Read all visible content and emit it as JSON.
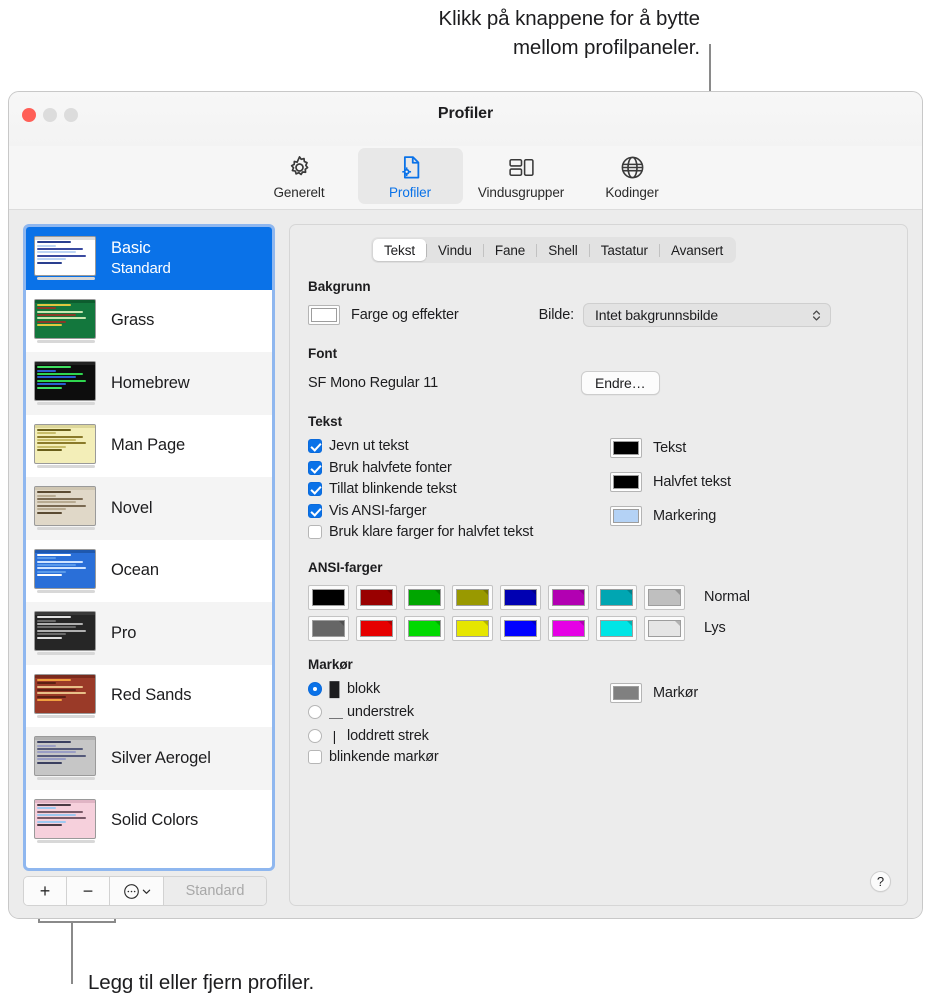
{
  "annotations": {
    "top": "Klikk på knappene for å bytte\nmellom profilpaneler.",
    "bottom": "Legg til eller fjern profiler."
  },
  "window": {
    "title": "Profiler",
    "traffic": {
      "close": "close-button",
      "minimize": "minimize-button",
      "maximize": "maximize-button"
    }
  },
  "toolbar": {
    "items": [
      {
        "label": "Generelt",
        "icon": "gear-icon",
        "selected": false
      },
      {
        "label": "Profiler",
        "icon": "document-gear-icon",
        "selected": true
      },
      {
        "label": "Vindusgrupper",
        "icon": "window-groups-icon",
        "selected": false
      },
      {
        "label": "Kodinger",
        "icon": "globe-icon",
        "selected": false
      }
    ]
  },
  "sidebar": {
    "profiles": [
      {
        "name": "Basic",
        "subtitle": "Standard",
        "selected": true,
        "thumb": {
          "bg": "#ffffff",
          "bar": "#dcdcdc",
          "text": "#3a4aa0",
          "hl": "#bcd4f5",
          "accent": "#2a3f8f"
        }
      },
      {
        "name": "Grass",
        "subtitle": "",
        "selected": false,
        "thumb": {
          "bg": "#13773d",
          "bar": "#0d5c2e",
          "text": "#c8e6b0",
          "hl": "#8a3a28",
          "accent": "#e0c840"
        }
      },
      {
        "name": "Homebrew",
        "subtitle": "",
        "selected": false,
        "thumb": {
          "bg": "#0d0d0d",
          "bar": "#222222",
          "text": "#2fd64f",
          "hl": "#2a5fd0",
          "accent": "#3fe060"
        }
      },
      {
        "name": "Man Page",
        "subtitle": "",
        "selected": false,
        "thumb": {
          "bg": "#f3eeb8",
          "bar": "#ddd79a",
          "text": "#8a7a2a",
          "hl": "#c8bd6a",
          "accent": "#6a5f1a"
        }
      },
      {
        "name": "Novel",
        "subtitle": "",
        "selected": false,
        "thumb": {
          "bg": "#e0d8c8",
          "bar": "#cfc6b2",
          "text": "#7a6a52",
          "hl": "#b8ab92",
          "accent": "#5a4a32"
        }
      },
      {
        "name": "Ocean",
        "subtitle": "",
        "selected": false,
        "thumb": {
          "bg": "#2a6fd8",
          "bar": "#1f58ad",
          "text": "#cfe4ff",
          "hl": "#5a9aea",
          "accent": "#ffffff"
        }
      },
      {
        "name": "Pro",
        "subtitle": "",
        "selected": false,
        "thumb": {
          "bg": "#262626",
          "bar": "#3a3a3a",
          "text": "#b0b0b0",
          "hl": "#6a6a6a",
          "accent": "#e0e0e0"
        }
      },
      {
        "name": "Red Sands",
        "subtitle": "",
        "selected": false,
        "thumb": {
          "bg": "#9a3a28",
          "bar": "#7a2a1c",
          "text": "#e8c088",
          "hl": "#5c2014",
          "accent": "#f0a040"
        }
      },
      {
        "name": "Silver Aerogel",
        "subtitle": "",
        "selected": false,
        "thumb": {
          "bg": "#c6c6c6",
          "bar": "#b0b0b0",
          "text": "#555a7a",
          "hl": "#9a9ec4",
          "accent": "#3a3f5f"
        }
      },
      {
        "name": "Solid Colors",
        "subtitle": "",
        "selected": false,
        "thumb": {
          "bg": "#f6d0dc",
          "bar": "#e0b4c4",
          "text": "#7a5a68",
          "hl": "#9ec8f0",
          "accent": "#4a3a44"
        }
      }
    ],
    "toolbar": {
      "add": "+",
      "remove": "−",
      "more": "⋯",
      "more_chevron": "⌄",
      "default_button": "Standard"
    }
  },
  "detail": {
    "tabs": [
      {
        "label": "Tekst",
        "active": true
      },
      {
        "label": "Vindu",
        "active": false
      },
      {
        "label": "Fane",
        "active": false
      },
      {
        "label": "Shell",
        "active": false
      },
      {
        "label": "Tastatur",
        "active": false
      },
      {
        "label": "Avansert",
        "active": false
      }
    ],
    "background": {
      "title": "Bakgrunn",
      "color_label": "Farge og effekter",
      "color_value": "#ffffff",
      "image_label": "Bilde:",
      "image_value": "Intet bakgrunnsbilde"
    },
    "font": {
      "title": "Font",
      "value": "SF Mono Regular 11",
      "change_button": "Endre…"
    },
    "text": {
      "title": "Tekst",
      "checkboxes": [
        {
          "label": "Jevn ut tekst",
          "checked": true
        },
        {
          "label": "Bruk halvfete fonter",
          "checked": true
        },
        {
          "label": "Tillat blinkende tekst",
          "checked": true
        },
        {
          "label": "Vis ANSI-farger",
          "checked": true
        },
        {
          "label": "Bruk klare farger for halvfet tekst",
          "checked": false
        }
      ],
      "wells": [
        {
          "label": "Tekst",
          "color": "#000000"
        },
        {
          "label": "Halvfet tekst",
          "color": "#000000"
        },
        {
          "label": "Markering",
          "color": "#b4d2f5"
        }
      ]
    },
    "ansi": {
      "title": "ANSI-farger",
      "rows": [
        {
          "label": "Normal",
          "colors": [
            "#000000",
            "#990000",
            "#00a600",
            "#999900",
            "#0000b2",
            "#b200b2",
            "#00a6b2",
            "#bfbfbf"
          ]
        },
        {
          "label": "Lys",
          "colors": [
            "#666666",
            "#e60000",
            "#00d900",
            "#e6e600",
            "#0000ff",
            "#e500e5",
            "#00e5e5",
            "#e5e5e5"
          ]
        }
      ]
    },
    "cursor": {
      "title": "Markør",
      "options": [
        {
          "label": "blokk",
          "glyph": "█",
          "selected": true
        },
        {
          "label": "understrek",
          "glyph": "＿",
          "selected": false
        },
        {
          "label": "loddrett strek",
          "glyph": "|",
          "selected": false
        }
      ],
      "blink": {
        "label": "blinkende markør",
        "checked": false
      },
      "well": {
        "label": "Markør",
        "color": "#808080"
      }
    },
    "help_button": "?"
  }
}
